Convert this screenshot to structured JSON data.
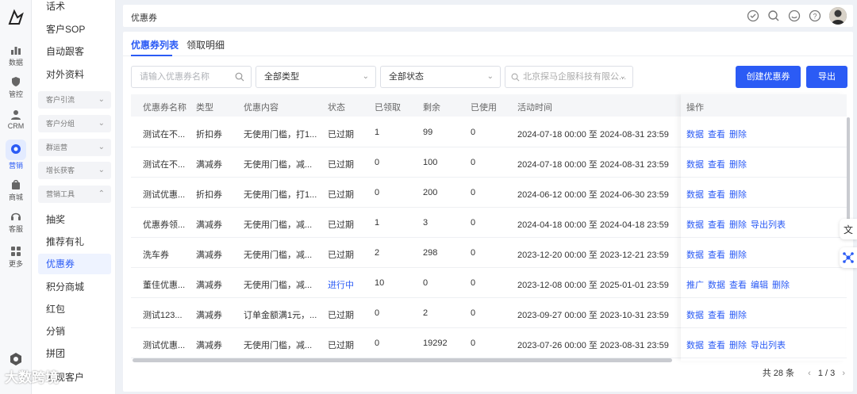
{
  "rail": {
    "items": [
      {
        "label": "数据",
        "icon": "chart-icon"
      },
      {
        "label": "管控",
        "icon": "shield-icon"
      },
      {
        "label": "CRM",
        "icon": "people-icon"
      },
      {
        "label": "营销",
        "icon": "marketing-icon"
      },
      {
        "label": "商城",
        "icon": "shop-icon"
      },
      {
        "label": "客服",
        "icon": "support-icon"
      },
      {
        "label": "更多",
        "icon": "grid-icon"
      }
    ]
  },
  "sidebar": {
    "items_top": [
      "话术",
      "客户SOP",
      "自动跟客",
      "对外资料"
    ],
    "groups": [
      "客户引流",
      "客户分组",
      "群运营",
      "增长获客",
      "营销工具"
    ],
    "items_bottom": [
      "抽奖",
      "推荐有礼",
      "优惠券",
      "积分商城",
      "红包",
      "分销",
      "拼团",
      "发现客户"
    ]
  },
  "header": {
    "title": "优惠券"
  },
  "tabs": [
    {
      "label": "优惠券列表"
    },
    {
      "label": "领取明细"
    }
  ],
  "filters": {
    "name_placeholder": "请输入优惠券名称",
    "type_value": "全部类型",
    "status_value": "全部状态",
    "company_value": "北京探马企服科技有限公..."
  },
  "buttons": {
    "create": "创建优惠券",
    "export": "导出"
  },
  "table": {
    "headers": [
      "优惠券名称",
      "类型",
      "优惠内容",
      "状态",
      "已领取",
      "剩余",
      "已使用",
      "活动时间",
      "操作"
    ],
    "rows": [
      {
        "name": "测试在不...",
        "type": "折扣券",
        "content": "无使用门槛，打1...",
        "status": "已过期",
        "claimed": "1",
        "remaining": "99",
        "used": "0",
        "time": "2024-07-18 00:00 至 2024-08-31 23:59",
        "ops": [
          "数据",
          "查看",
          "删除"
        ]
      },
      {
        "name": "测试在不...",
        "type": "满减券",
        "content": "无使用门槛，减...",
        "status": "已过期",
        "claimed": "0",
        "remaining": "100",
        "used": "0",
        "time": "2024-07-18 00:00 至 2024-08-31 23:59",
        "ops": [
          "数据",
          "查看",
          "删除"
        ]
      },
      {
        "name": "测试优惠...",
        "type": "折扣券",
        "content": "无使用门槛，打1...",
        "status": "已过期",
        "claimed": "0",
        "remaining": "200",
        "used": "0",
        "time": "2024-06-12 00:00 至 2024-06-30 23:59",
        "ops": [
          "数据",
          "查看",
          "删除"
        ]
      },
      {
        "name": "优惠券领...",
        "type": "满减券",
        "content": "无使用门槛，减...",
        "status": "已过期",
        "claimed": "1",
        "remaining": "3",
        "used": "0",
        "time": "2024-04-18 00:00 至 2024-04-18 23:59",
        "ops": [
          "数据",
          "查看",
          "删除",
          "导出列表"
        ]
      },
      {
        "name": "洗车券",
        "type": "满减券",
        "content": "无使用门槛，减...",
        "status": "已过期",
        "claimed": "2",
        "remaining": "298",
        "used": "0",
        "time": "2023-12-20 00:00 至 2023-12-21 23:59",
        "ops": [
          "数据",
          "查看",
          "删除"
        ]
      },
      {
        "name": "董佳优惠...",
        "type": "满减券",
        "content": "无使用门槛，减...",
        "status": "进行中",
        "claimed": "10",
        "remaining": "0",
        "used": "0",
        "time": "2023-12-08 00:00 至 2025-01-01 23:59",
        "ops": [
          "推广",
          "数据",
          "查看",
          "编辑",
          "删除"
        ]
      },
      {
        "name": "测试123...",
        "type": "满减券",
        "content": "订单金额满1元，...",
        "status": "已过期",
        "claimed": "0",
        "remaining": "2",
        "used": "0",
        "time": "2023-09-27 00:00 至 2023-10-31 23:59",
        "ops": [
          "数据",
          "查看",
          "删除"
        ]
      },
      {
        "name": "测试优惠...",
        "type": "满减券",
        "content": "无使用门槛，减...",
        "status": "已过期",
        "claimed": "0",
        "remaining": "19292",
        "used": "0",
        "time": "2023-07-26 00:00 至 2023-08-31 23:59",
        "ops": [
          "数据",
          "查看",
          "删除",
          "导出列表"
        ]
      }
    ]
  },
  "pager": {
    "total": "共 28 条",
    "page": "1 / 3"
  },
  "watermark": "大数跨境",
  "colors": {
    "accent": "#2b5bf5",
    "active_status": "#2b5bf5"
  }
}
